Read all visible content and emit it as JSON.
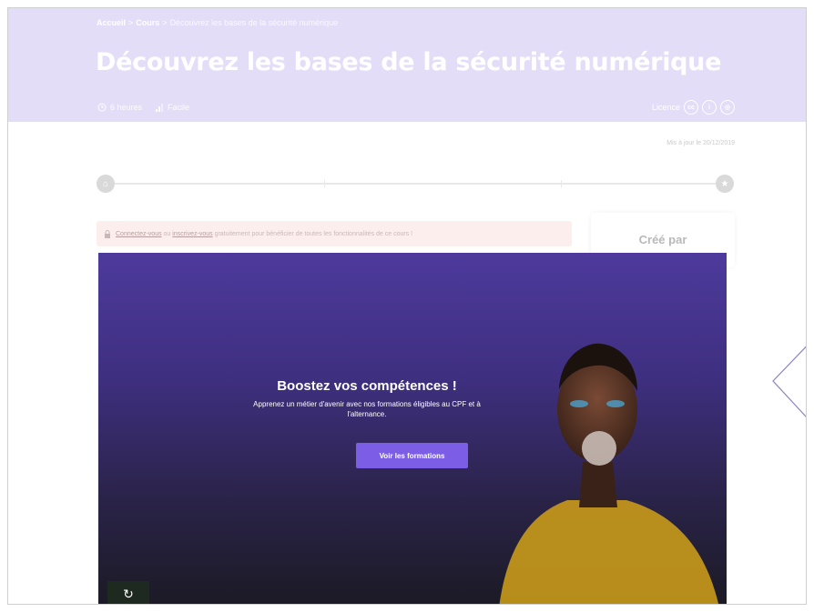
{
  "breadcrumb": {
    "home": "Accueil",
    "sep": ">",
    "courses": "Cours",
    "current": "Découvrez les bases de la sécurité numérique"
  },
  "course": {
    "title": "Découvrez les bases de la sécurité numérique",
    "duration": "6 heures",
    "difficulty": "Facile",
    "licence_label": "Licence",
    "licence_icons": [
      "cc-icon",
      "by-icon",
      "sa-icon"
    ],
    "updated": "Mis à jour le 20/12/2019"
  },
  "login_notice": {
    "link1": "Connectez-vous",
    "middle": " ou ",
    "link2": "inscrivez-vous",
    "rest": " gratuitement pour bénéficier de toutes les fonctionnalités de ce cours !"
  },
  "author": {
    "title": "Créé par"
  },
  "promo": {
    "title": "Boostez vos compétences !",
    "subtitle": "Apprenez un métier d'avenir avec nos formations éligibles au CPF et à l'alternance.",
    "button": "Voir les formations",
    "replay_icon": "↻"
  },
  "colors": {
    "hero": "#e3ddf7",
    "accent": "#7c5ee6",
    "promo_top": "#4d3a9c",
    "promo_bottom": "#1b1a24"
  }
}
